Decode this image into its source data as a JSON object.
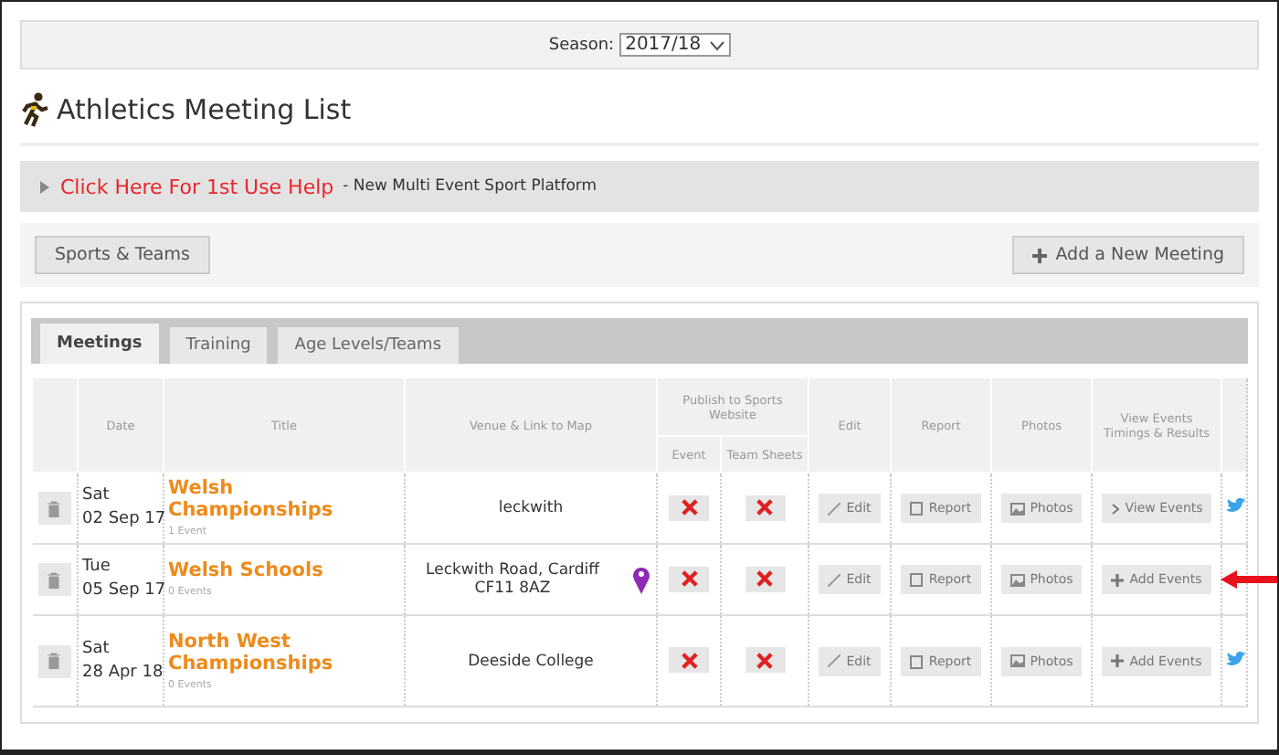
{
  "season": {
    "label": "Season:",
    "value": "2017/18"
  },
  "page_title": "Athletics Meeting List",
  "help": {
    "link": "Click Here For 1st Use Help",
    "text": "- New Multi Event Sport Platform",
    "expanded": false
  },
  "toolbar": {
    "left_button": "Sports & Teams",
    "right_button": "Add a New Meeting"
  },
  "tabs": [
    {
      "label": "Meetings",
      "selected": true
    },
    {
      "label": "Training",
      "selected": false
    },
    {
      "label": "Age Levels/Teams",
      "selected": false
    }
  ],
  "table": {
    "columns": [
      "Date",
      "Title",
      "Venue & Link to Map",
      "Publish to Sports Website",
      "Edit",
      "Report",
      "Photos",
      "View Events Timings & Results"
    ],
    "subcolumns": [
      "Event",
      "Team Sheets"
    ],
    "rows": [
      {
        "day": "Sat",
        "date": "02 Sep 17",
        "title": "Welsh Championships",
        "events": "1 Event",
        "venue": "leckwith",
        "map_pin": false,
        "publish_event": false,
        "publish_team": false,
        "edit": "Edit",
        "report": "Report",
        "photos": "Photos",
        "events_button": {
          "kind": "view",
          "label": "View Events"
        },
        "twitter": true,
        "pointer": false
      },
      {
        "day": "Tue",
        "date": "05 Sep 17",
        "title": "Welsh Schools",
        "events": "0 Events",
        "venue": "Leckwith Road, Cardiff CF11 8AZ",
        "map_pin": true,
        "publish_event": false,
        "publish_team": false,
        "edit": "Edit",
        "report": "Report",
        "photos": "Photos",
        "events_button": {
          "kind": "add",
          "label": "Add Events"
        },
        "twitter": false,
        "pointer": true
      },
      {
        "day": "Sat",
        "date": "28 Apr 18",
        "title": "North West Championships",
        "events": "0 Events",
        "venue": "Deeside College",
        "map_pin": false,
        "publish_event": false,
        "publish_team": false,
        "edit": "Edit",
        "report": "Report",
        "photos": "Photos",
        "events_button": {
          "kind": "add",
          "label": "Add Events"
        },
        "twitter": true,
        "pointer": false
      }
    ]
  }
}
